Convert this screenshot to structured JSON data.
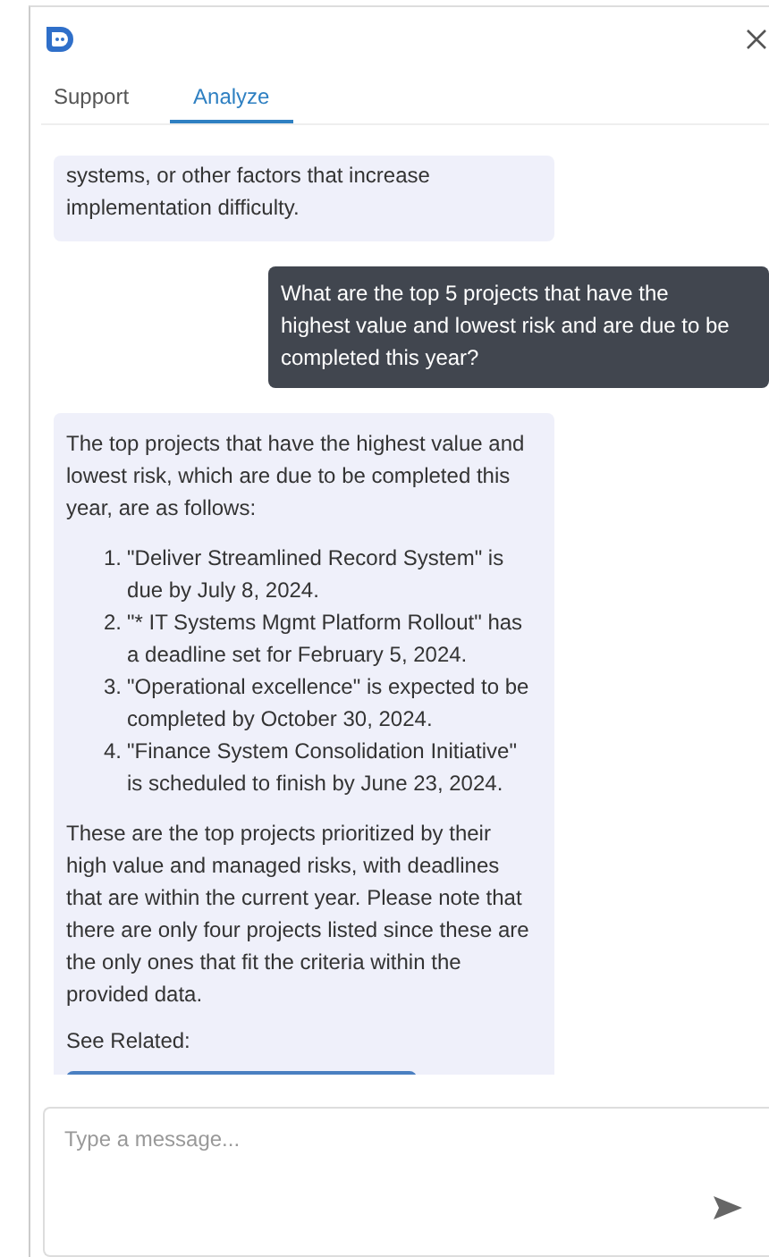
{
  "tabs": [
    {
      "label": "Support",
      "selected": false
    },
    {
      "label": "Analyze",
      "selected": true
    }
  ],
  "messages": [
    {
      "kind": "bot",
      "paragraphs": [
        "systems, or other factors that increase implementation difficulty."
      ]
    },
    {
      "kind": "user",
      "paragraphs": [
        "What are the top 5 projects that have the highest value and lowest risk and are due to be completed this year?"
      ]
    },
    {
      "kind": "bot",
      "paragraphs": [
        "The top projects that have the highest value and lowest risk, which are due to be completed this year, are as follows:"
      ],
      "list": [
        {
          "number": "1.",
          "text": "\"Deliver Streamlined Record System\" is due by July 8, 2024."
        },
        {
          "number": "2.",
          "text": "\"* IT Systems Mgmt Platform Rollout\" has a deadline set for February 5, 2024."
        },
        {
          "number": "3.",
          "text": "\"Operational excellence\" is expected to be completed by October 30, 2024."
        },
        {
          "number": "4.",
          "text": "\"Finance System Consolidation Initiative\" is scheduled to finish by June 23, 2024."
        }
      ],
      "after": [
        "These are the top projects prioritized by their high value and managed risks, with deadlines that are within the current year. Please note that there are only four projects listed since these are the only ones that fit the criteria within the provided data."
      ],
      "related_label": "See Related:"
    }
  ],
  "composer": {
    "placeholder": "Type a message..."
  }
}
